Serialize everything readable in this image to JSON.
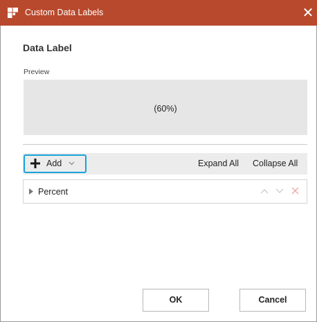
{
  "window": {
    "title": "Custom Data Labels",
    "close_glyph": "✕",
    "accent_color": "#b9492c"
  },
  "section": {
    "title": "Data Label"
  },
  "preview": {
    "label": "Preview",
    "value": "(60%)"
  },
  "toolbar": {
    "add_label": "Add",
    "add_icon": "plus-icon",
    "expand_all_label": "Expand All",
    "collapse_all_label": "Collapse All",
    "focus_color": "#19a2d9"
  },
  "list": {
    "items": [
      {
        "label": "Percent",
        "expanded": false
      }
    ]
  },
  "footer": {
    "ok_label": "OK",
    "cancel_label": "Cancel"
  }
}
